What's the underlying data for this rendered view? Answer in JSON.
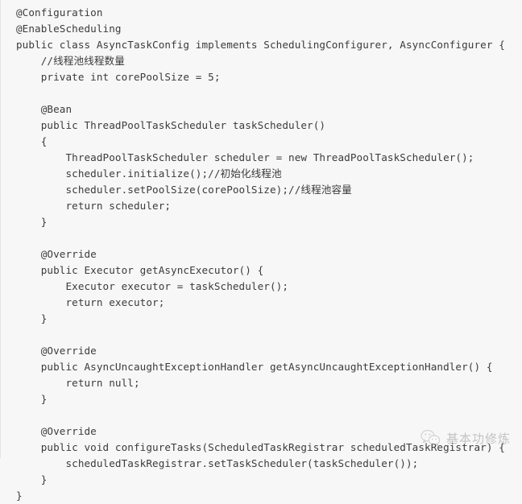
{
  "document": {
    "kind": "code-snippet",
    "language": "java",
    "background_color": "#f7f7f7",
    "text_color": "#3b3b3b",
    "border_color": "#e3e3e3",
    "lines": [
      "@Configuration",
      "@EnableScheduling",
      "public class AsyncTaskConfig implements SchedulingConfigurer, AsyncConfigurer {",
      "    //线程池线程数量",
      "    private int corePoolSize = 5;",
      "",
      "    @Bean",
      "    public ThreadPoolTaskScheduler taskScheduler()",
      "    {",
      "        ThreadPoolTaskScheduler scheduler = new ThreadPoolTaskScheduler();",
      "        scheduler.initialize();//初始化线程池",
      "        scheduler.setPoolSize(corePoolSize);//线程池容量",
      "        return scheduler;",
      "    }",
      "",
      "    @Override",
      "    public Executor getAsyncExecutor() {",
      "        Executor executor = taskScheduler();",
      "        return executor;",
      "    }",
      "",
      "    @Override",
      "    public AsyncUncaughtExceptionHandler getAsyncUncaughtExceptionHandler() {",
      "        return null;",
      "    }",
      "",
      "    @Override",
      "    public void configureTasks(ScheduledTaskRegistrar scheduledTaskRegistrar) {",
      "        scheduledTaskRegistrar.setTaskScheduler(taskScheduler());",
      "    }",
      "}"
    ]
  },
  "watermark": {
    "icon": "wechat-icon",
    "text": "基本功修炼",
    "color": "#7d7d7d"
  }
}
